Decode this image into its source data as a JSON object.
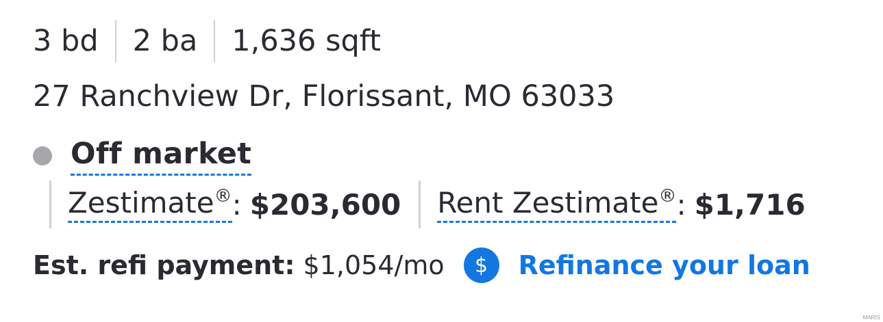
{
  "facts": {
    "beds": "3 bd",
    "baths": "2 ba",
    "sqft": "1,636 sqft"
  },
  "address": "27 Ranchview Dr, Florissant, MO 63033",
  "status": {
    "label": "Off market",
    "dot_color": "#a7a6ab"
  },
  "zestimate": {
    "label": "Zestimate",
    "mark": "®",
    "colon": ":",
    "value": "$203,600"
  },
  "rent_zestimate": {
    "label": "Rent Zestimate",
    "mark": "®",
    "colon": ":",
    "value": "$1,716"
  },
  "refi": {
    "label": "Est. refi payment:",
    "value": "$1,054/mo",
    "icon": "dollar-icon",
    "icon_glyph": "$",
    "link_label": "Refinance your loan",
    "accent_color": "#1277e1"
  },
  "watermark": "MARIS"
}
